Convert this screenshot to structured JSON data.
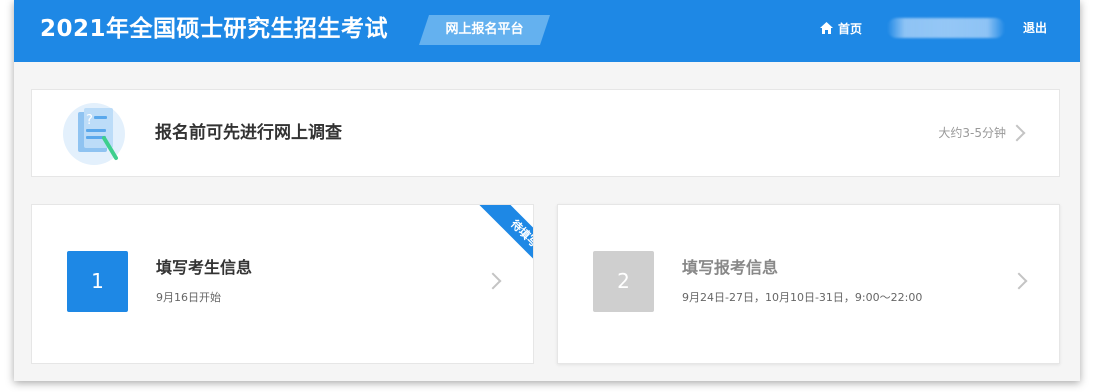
{
  "header": {
    "title": "2021年全国硕士研究生招生考试",
    "platform_label": "网上报名平台",
    "home_label": "首页",
    "home_icon": "home-icon",
    "logout_label": "退出"
  },
  "survey": {
    "icon": "questionnaire-icon",
    "label": "报名前可先进行网上调查",
    "duration": "大约3-5分钟"
  },
  "steps": [
    {
      "number": "1",
      "title": "填写考生信息",
      "date": "9月16日开始",
      "ribbon": "待填写",
      "color": "#1e88e5"
    },
    {
      "number": "2",
      "title": "填写报考信息",
      "date": "9月24日-27日，10月10日-31日，9:00～22:00",
      "color": "#cfcfcf"
    }
  ],
  "colors": {
    "brand_blue": "#1e88e5",
    "platform_tag": "#64b1ef",
    "disabled_gray": "#cfcfcf"
  }
}
